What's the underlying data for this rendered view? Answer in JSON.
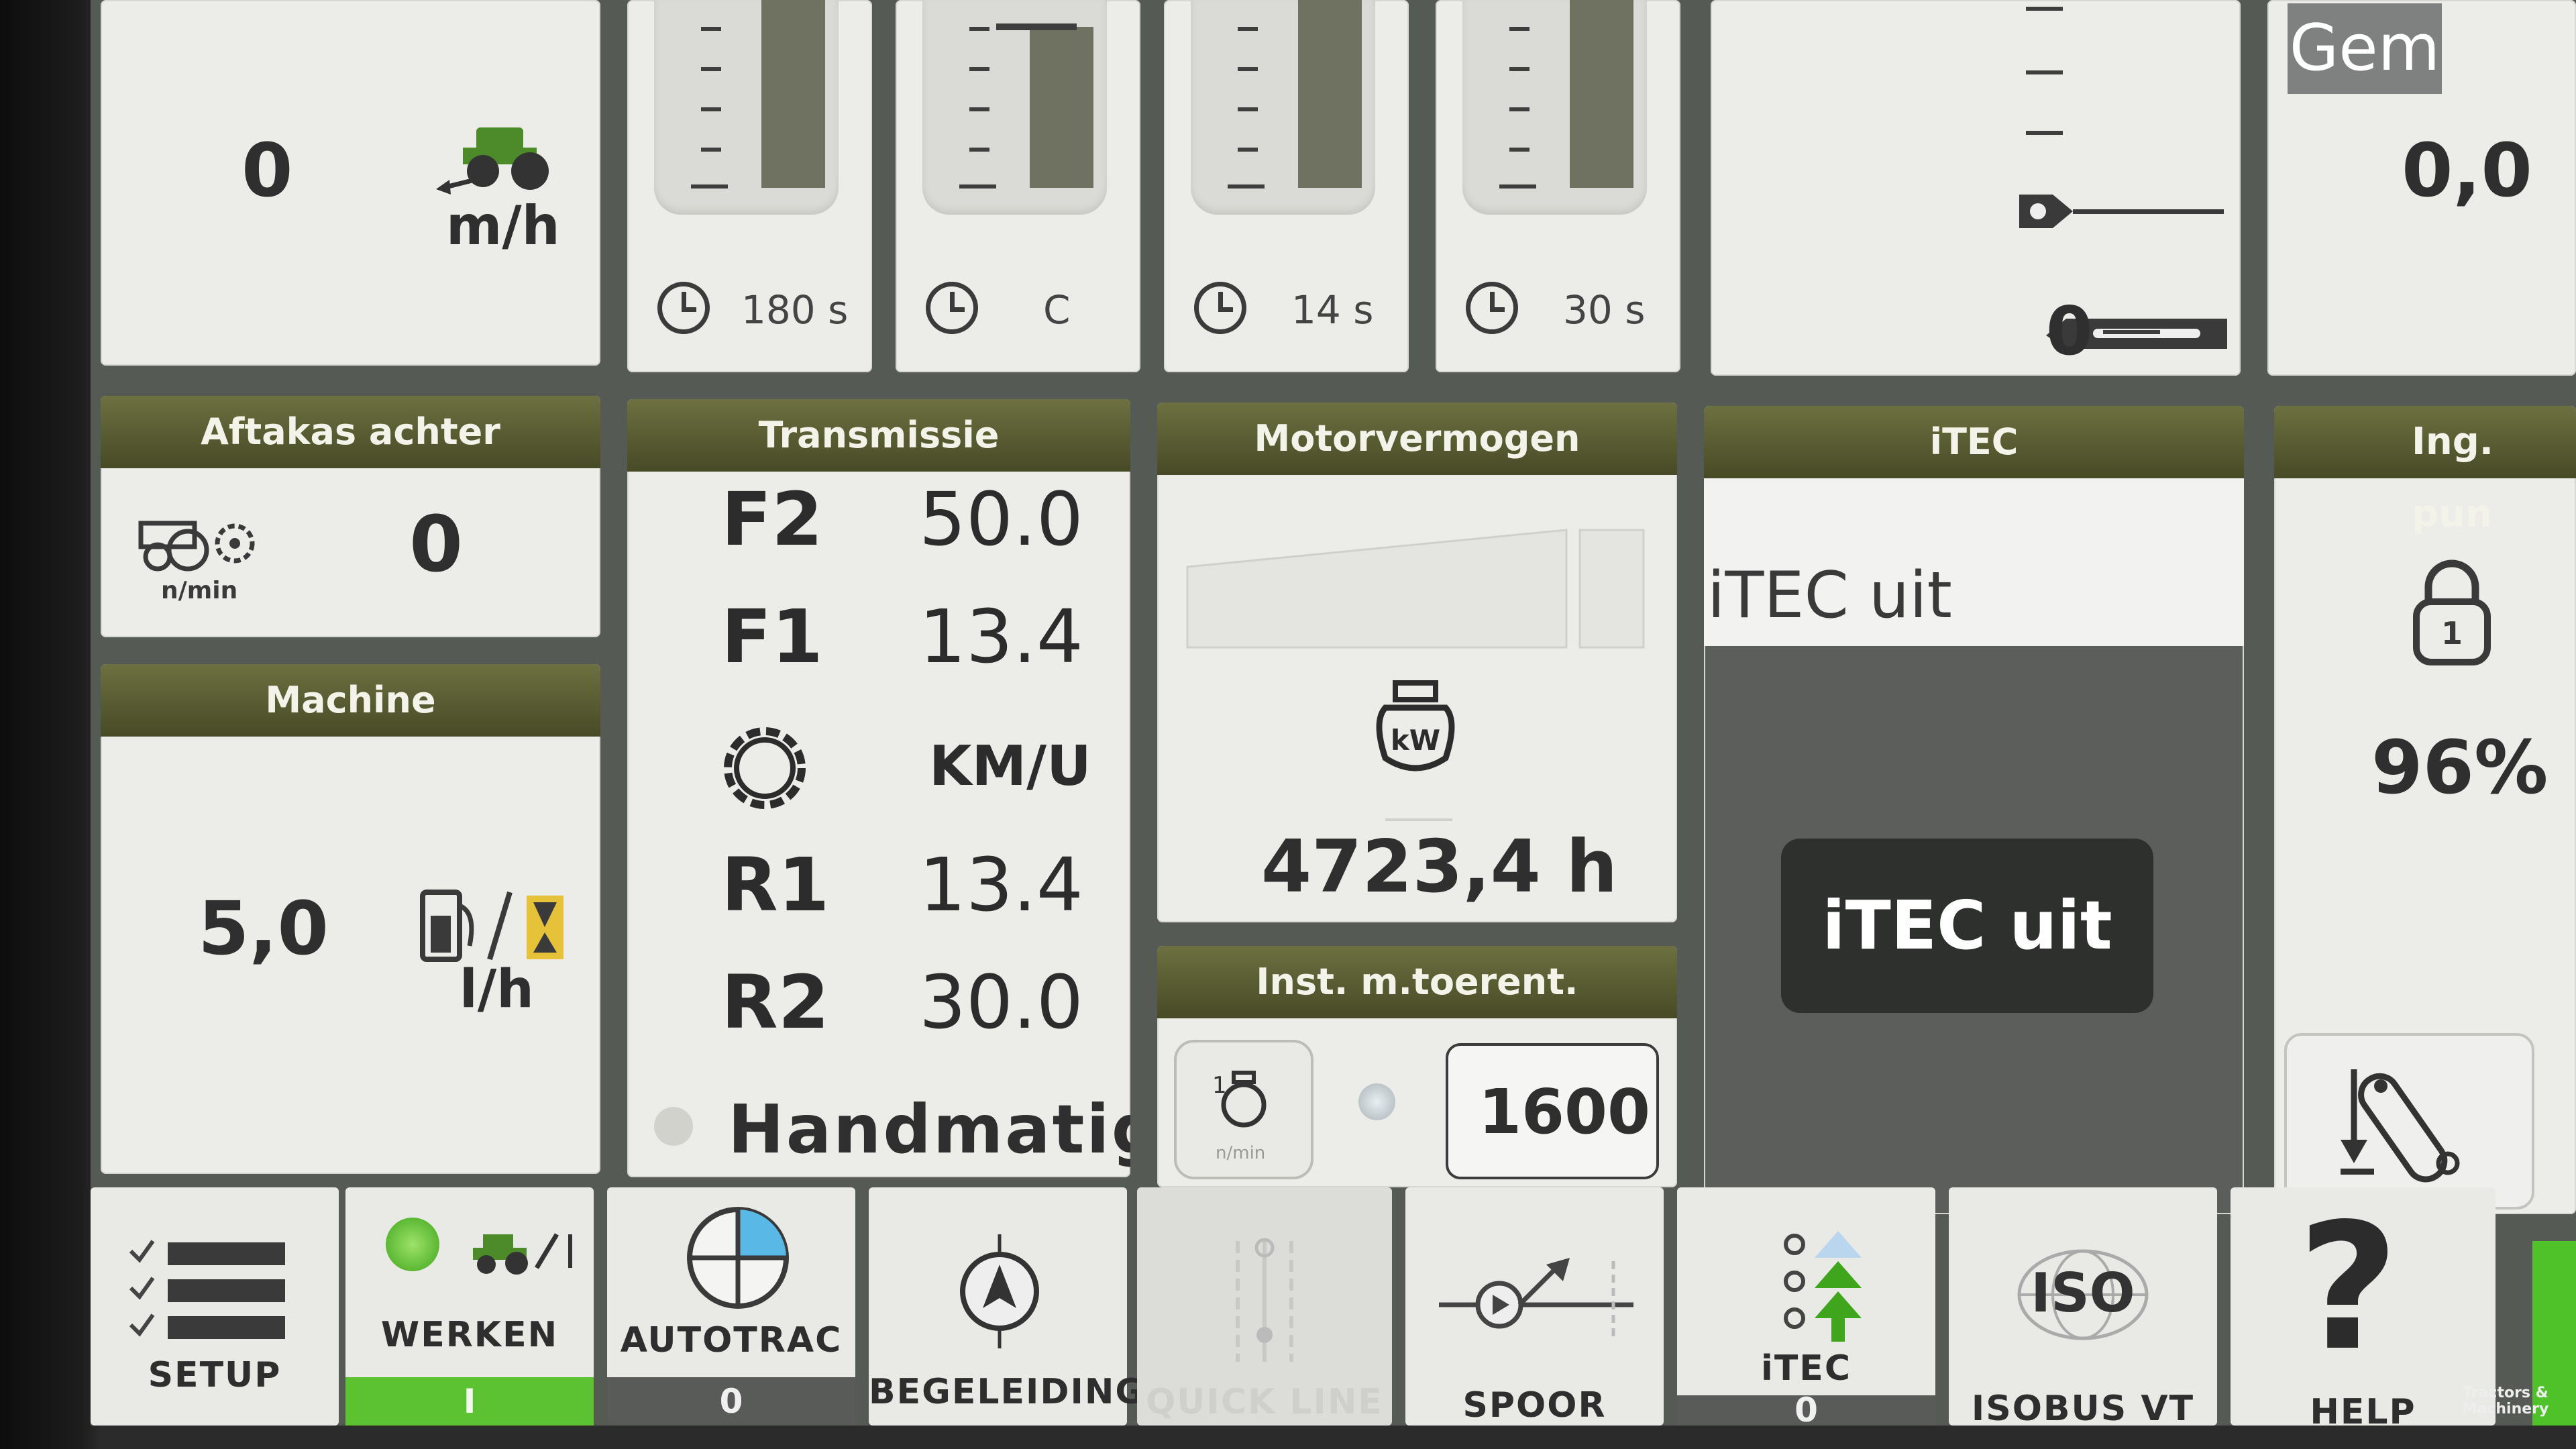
{
  "speed_tile": {
    "value": "0",
    "unit": "m/h"
  },
  "timers": [
    "180 s",
    "C",
    "14 s",
    "30 s"
  ],
  "hitch": {
    "zero": "0"
  },
  "gem": {
    "label": "Gem",
    "value": "0,0"
  },
  "pto": {
    "title": "Aftakas achter",
    "value": "0",
    "unit": "n/min"
  },
  "machine": {
    "title": "Machine",
    "value": "5,0",
    "unit": "l/h"
  },
  "transmission": {
    "title": "Transmissie",
    "rows": [
      {
        "gear": "F2",
        "speed": "50.0"
      },
      {
        "gear": "F1",
        "speed": "13.4"
      },
      {
        "gear": "",
        "speed": "KM/U"
      },
      {
        "gear": "R1",
        "speed": "13.4"
      },
      {
        "gear": "R2",
        "speed": "30.0"
      }
    ],
    "mode": "Handmatig"
  },
  "engine": {
    "title": "Motorvermogen",
    "hours": "4723,4 h",
    "kw": "kW"
  },
  "rpm_setting": {
    "title": "Inst. m.toerent.",
    "value": "1600",
    "icon_unit": "n/min"
  },
  "itec": {
    "title": "iTEC",
    "status": "iTEC uit",
    "button": "iTEC uit"
  },
  "ing": {
    "title": "Ing. pun",
    "value": "96%"
  },
  "bottom": {
    "setup": "SETUP",
    "werken": "WERKEN",
    "werken_state": "I",
    "autotrac": "AUTOTRAC",
    "autotrac_state": "0",
    "begeleiding": "BEGELEIDING",
    "quickline": "QUICK LINE",
    "spoor": "SPOOR WISS.",
    "itec": "iTEC",
    "itec_state": "0",
    "isobus": "ISOBUS VT",
    "iso": "ISO",
    "help": "HELP"
  },
  "watermark": "Tractors & Machinery"
}
